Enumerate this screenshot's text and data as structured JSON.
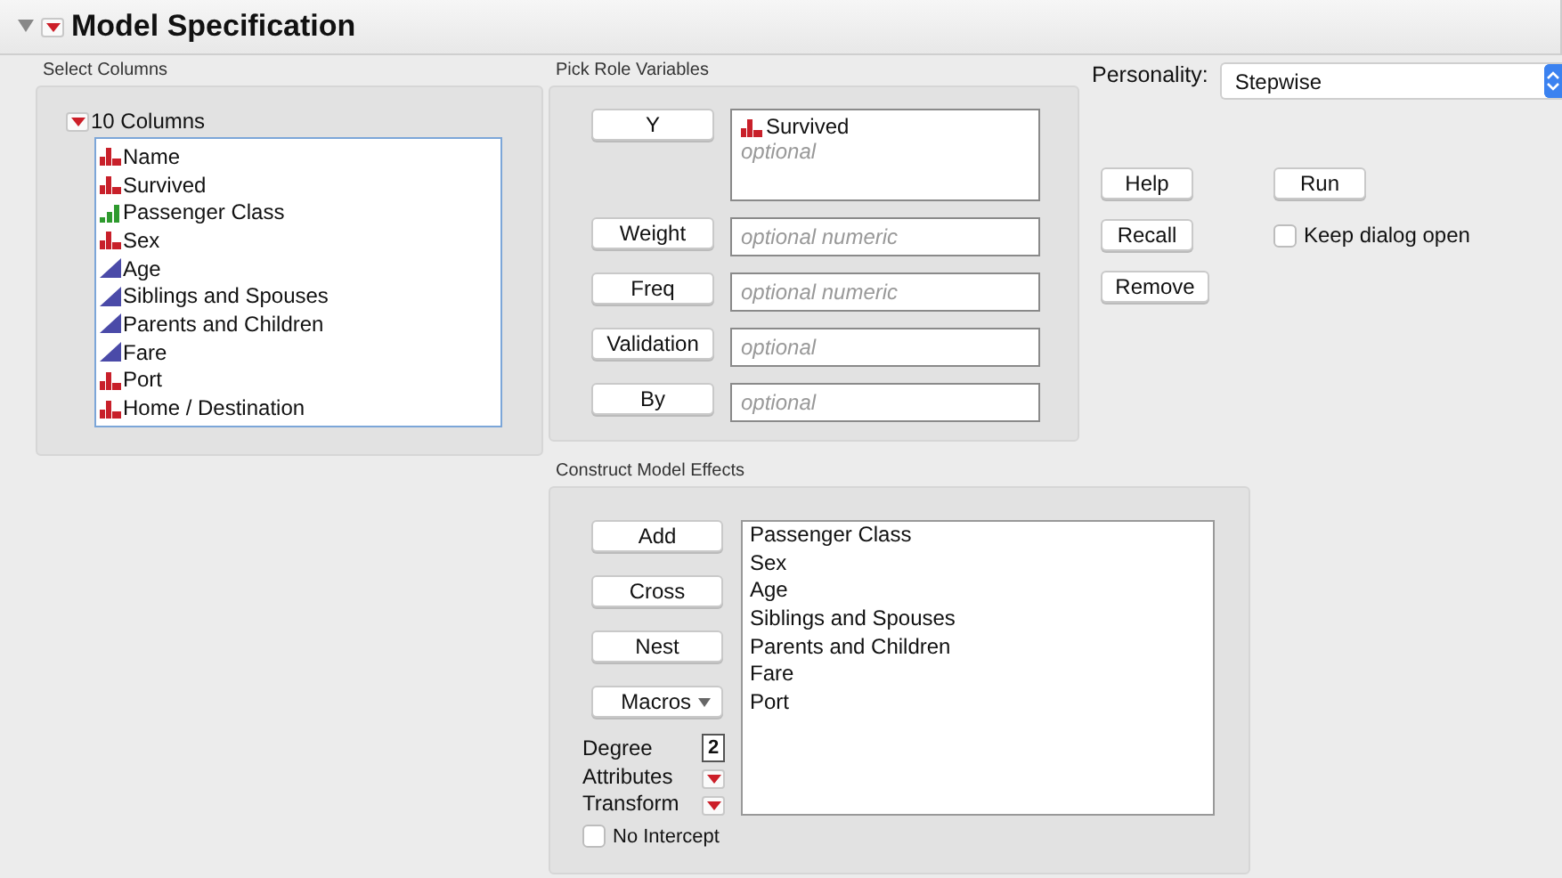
{
  "title": "Model Specification",
  "select_columns": {
    "heading": "Select Columns",
    "group_label": "10 Columns",
    "columns": [
      {
        "name": "Name",
        "kind": "nominal"
      },
      {
        "name": "Survived",
        "kind": "nominal"
      },
      {
        "name": "Passenger Class",
        "kind": "ordinal"
      },
      {
        "name": "Sex",
        "kind": "nominal"
      },
      {
        "name": "Age",
        "kind": "continuous"
      },
      {
        "name": "Siblings and Spouses",
        "kind": "continuous"
      },
      {
        "name": "Parents and Children",
        "kind": "continuous"
      },
      {
        "name": "Fare",
        "kind": "continuous"
      },
      {
        "name": "Port",
        "kind": "nominal"
      },
      {
        "name": "Home / Destination",
        "kind": "nominal"
      }
    ]
  },
  "pick_roles": {
    "heading": "Pick Role Variables",
    "roles": [
      {
        "button": "Y",
        "values": [
          {
            "name": "Survived",
            "kind": "nominal"
          }
        ],
        "placeholder": "optional"
      },
      {
        "button": "Weight",
        "placeholder": "optional numeric"
      },
      {
        "button": "Freq",
        "placeholder": "optional numeric"
      },
      {
        "button": "Validation",
        "placeholder": "optional"
      },
      {
        "button": "By",
        "placeholder": "optional"
      }
    ]
  },
  "personality": {
    "label": "Personality:",
    "value": "Stepwise"
  },
  "actions": {
    "help": "Help",
    "run": "Run",
    "recall": "Recall",
    "remove": "Remove",
    "keep_open": {
      "label": "Keep dialog open",
      "checked": false
    }
  },
  "effects": {
    "heading": "Construct Model Effects",
    "buttons": [
      "Add",
      "Cross",
      "Nest"
    ],
    "macros": "Macros",
    "degree_label": "Degree",
    "degree": "2",
    "attributes": "Attributes",
    "transform": "Transform",
    "no_intercept": {
      "label": "No Intercept",
      "checked": false
    },
    "items": [
      "Passenger Class",
      "Sex",
      "Age",
      "Siblings and Spouses",
      "Parents and Children",
      "Fare",
      "Port"
    ]
  }
}
